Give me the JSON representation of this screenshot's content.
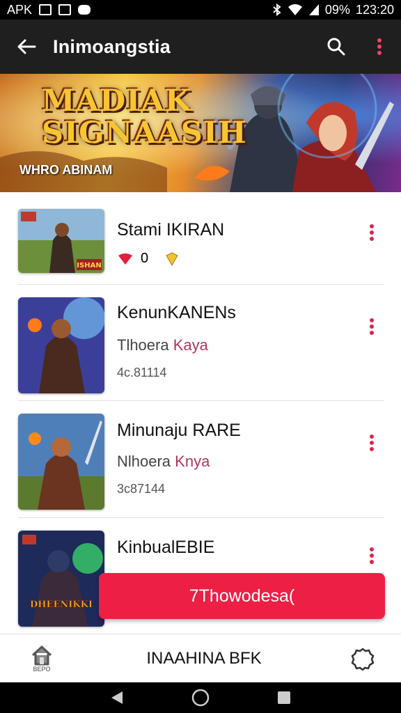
{
  "status_bar": {
    "left_label": "APK",
    "right_value": "09%",
    "time": "123:20"
  },
  "app_bar": {
    "title": "Inimoangstia",
    "back_icon": "arrow-left-icon",
    "search_icon": "search-icon",
    "menu_icon": "more-vertical-icon"
  },
  "banner": {
    "logo_line1": "MADIAK",
    "logo_line2": "SIGNAASIH",
    "subtitle": "WHRO ABINAM"
  },
  "items": [
    {
      "name": "Stami IKIRAN",
      "meta_icons": [
        "heart-badge-icon",
        "shield-icon"
      ],
      "meta_value": "0",
      "thumb_label": "ISHAN"
    },
    {
      "name": "KenunKANENs",
      "sub_prefix": "Tlhoera",
      "sub_accent": "Kaya",
      "count": "4c.81114"
    },
    {
      "name": "Minunaju RARE",
      "sub_prefix": "Nlhoera",
      "sub_accent": "Knya",
      "count": "3c87144"
    },
    {
      "name": "KinbualEBIE",
      "thumb_label": "DHEENIKKI"
    }
  ],
  "fab": {
    "label": "7Thowodesa("
  },
  "bottom_nav": {
    "home_label": "BEPO",
    "center_label": "INAAHINA BFK"
  },
  "colors": {
    "accent": "#ee1f45",
    "appbar": "#1f1f1f",
    "accent_text": "#b2365a"
  }
}
